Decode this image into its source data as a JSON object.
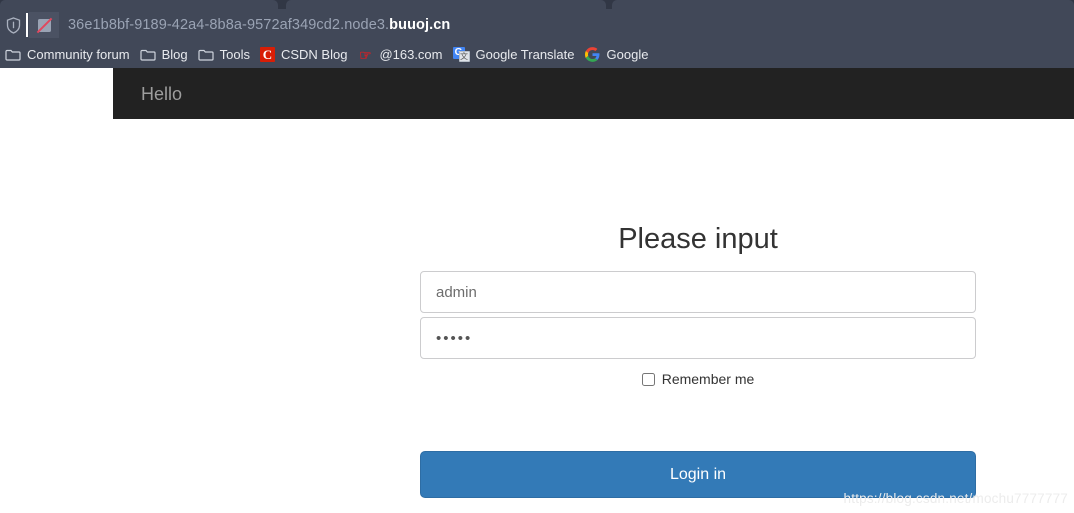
{
  "browser": {
    "omnibox": {
      "shield_icon": "shield-icon",
      "security_icon": "not-secure-icon",
      "url_subdomain": "36e1b8bf-9189-42a4-8b8a-9572af349cd2.node3.",
      "url_domain": "buuoj.cn",
      "url_full": "36e1b8bf-9189-42a4-8b8a-9572af349cd2.node3.buuoj.cn"
    },
    "bookmarks": [
      {
        "label": "Community forum",
        "icon": "folder-icon"
      },
      {
        "label": "Blog",
        "icon": "folder-icon"
      },
      {
        "label": "Tools",
        "icon": "folder-icon"
      },
      {
        "label": "CSDN Blog",
        "icon": "csdn-icon"
      },
      {
        "label": "@163.com",
        "icon": "netease-icon"
      },
      {
        "label": "Google Translate",
        "icon": "google-translate-icon"
      },
      {
        "label": "Google",
        "icon": "google-icon"
      }
    ]
  },
  "page": {
    "navbar": {
      "brand": "Hello"
    },
    "heading": "Please input",
    "form": {
      "username": {
        "value": "",
        "placeholder": "admin"
      },
      "password": {
        "value": "•••••",
        "placeholder": ""
      },
      "remember_label": "Remember me",
      "remember_checked": false,
      "submit_label": "Login in"
    },
    "watermark": "https://blog.csdn.net/mochu7777777"
  },
  "colors": {
    "chrome_bg": "#414858",
    "tabstrip_bg": "#313745",
    "navbar_bg": "#222222",
    "navbar_text": "#9d9d9d",
    "primary": "#337ab7",
    "primary_border": "#2e6da4",
    "input_border": "#ccccce",
    "heading_text": "#333333",
    "watermark_text": "#ececec"
  }
}
